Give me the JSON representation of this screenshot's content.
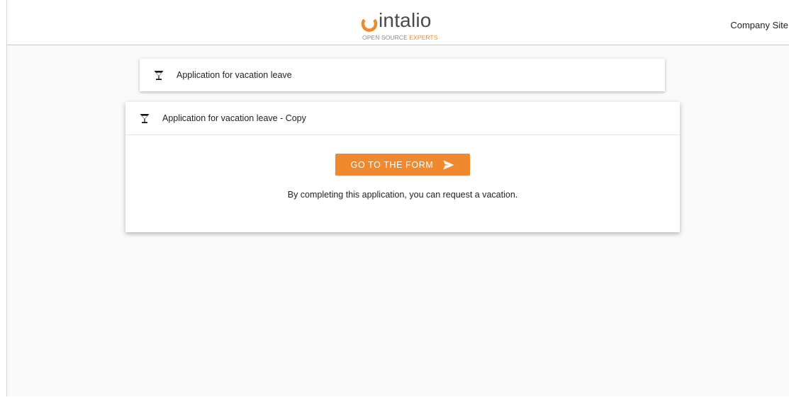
{
  "header": {
    "logo_word": "intalio",
    "logo_tag_left": "OPEN SOURCE ",
    "logo_tag_accent": "EXPERTS",
    "company_link": "Company Site"
  },
  "cards": [
    {
      "icon": "cocktail-glass-icon",
      "title": "Application for vacation leave",
      "expanded": false
    },
    {
      "icon": "cocktail-glass-icon",
      "title": "Application for vacation leave - Copy",
      "expanded": true,
      "button_label": "GO TO THE FORM",
      "button_icon": "send-arrow-icon",
      "description": "By completing this application, you can request a vacation."
    }
  ],
  "colors": {
    "accent": "#f0892e",
    "background": "#fafafa",
    "header_bg": "#ffffff",
    "text": "#222222"
  }
}
